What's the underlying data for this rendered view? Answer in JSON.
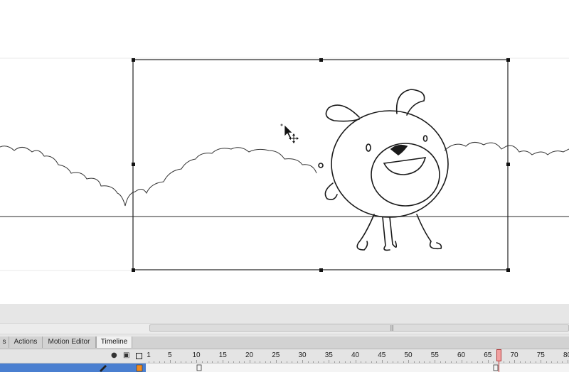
{
  "tabs": [
    {
      "label": "s",
      "active": false
    },
    {
      "label": "Actions",
      "active": false
    },
    {
      "label": "Motion Editor",
      "active": false
    },
    {
      "label": "Timeline",
      "active": true
    }
  ],
  "timeline": {
    "frame_numbers": [
      "1",
      "5",
      "10",
      "15",
      "20",
      "25",
      "30",
      "35",
      "40",
      "45",
      "50",
      "55",
      "60",
      "65",
      "70",
      "75",
      "80"
    ],
    "current_frame": 67,
    "header_icons": [
      "eye-icon",
      "lock-icon",
      "outline-icon"
    ]
  },
  "colors": {
    "stage_bg": "#ffffff",
    "drawing_stroke": "#222222",
    "layer_selected": "#4a7fd0",
    "playhead": "#c03030"
  }
}
